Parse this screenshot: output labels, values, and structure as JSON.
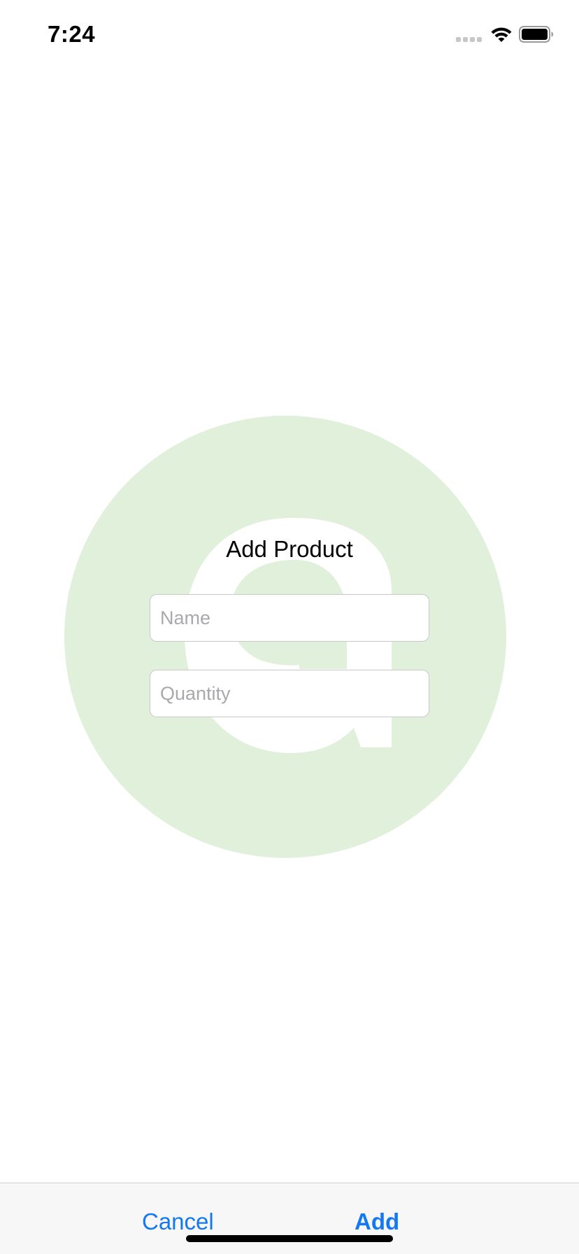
{
  "status_bar": {
    "time": "7:24",
    "signal_icon": "cellular-signal-icon",
    "wifi_icon": "wifi-icon",
    "battery_icon": "battery-icon"
  },
  "background_logo": {
    "icon": "green-circle-logo-icon",
    "color": "#e1f0da"
  },
  "form": {
    "title": "Add Product",
    "name_field": {
      "placeholder": "Name",
      "value": ""
    },
    "quantity_field": {
      "placeholder": "Quantity",
      "value": ""
    }
  },
  "toolbar": {
    "cancel_label": "Cancel",
    "add_label": "Add",
    "accent": "#1478f0"
  }
}
